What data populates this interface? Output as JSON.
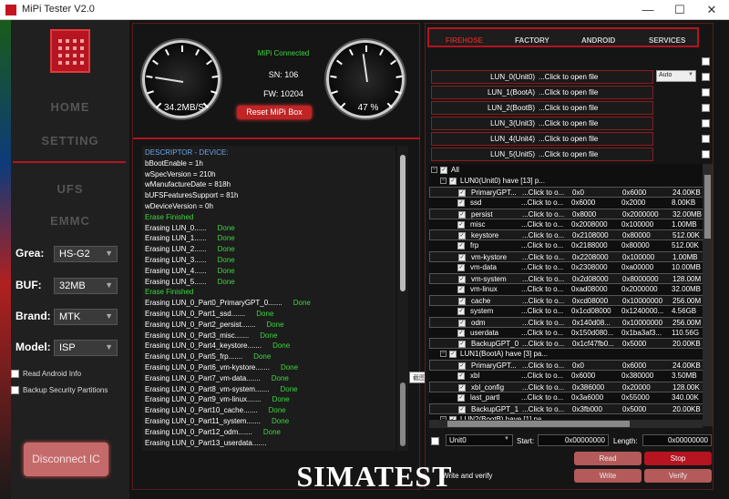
{
  "window": {
    "title": "MiPi Tester V2.0",
    "min": "—",
    "max": "☐",
    "close": "✕"
  },
  "nav": {
    "home": "HOME",
    "setting": "SETTING",
    "ufs": "UFS",
    "emmc": "EMMC"
  },
  "form": [
    {
      "label": "Grea:",
      "value": "HS-G2"
    },
    {
      "label": "BUF:",
      "value": "32MB"
    },
    {
      "label": "Brand:",
      "value": "MTK"
    },
    {
      "label": "Model:",
      "value": "ISP"
    }
  ],
  "options": {
    "read_android_info": "Read Android Info",
    "backup_security": "Backup Security Partitions"
  },
  "disconnect": "Disconnect IC",
  "gauges": {
    "speed": "34.2MB/S",
    "speed_fraction": 0.2,
    "percent": "47 %",
    "percent_fraction": 0.47
  },
  "status": {
    "connected": "MiPi Connected",
    "sn": "SN: 106",
    "fw": "FW: 10204",
    "reset": "Reset MiPi Box"
  },
  "log": [
    {
      "k": "DESCRIPTOR - DEVICE:",
      "v": "",
      "c": "lb"
    },
    {
      "k": "bBootEnable      =   1h",
      "v": "",
      "c": "lk"
    },
    {
      "k": "wSpecVersion     = 210h",
      "v": "",
      "c": "lk"
    },
    {
      "k": "wManufactureDate   = 818h",
      "v": "",
      "c": "lk"
    },
    {
      "k": "bUFSFeaturesSupport =  81h",
      "v": "",
      "c": "lk"
    },
    {
      "k": "wDeviceVersion    =  0h",
      "v": "",
      "c": "lk"
    },
    {
      "k": "Erase Finished",
      "v": "",
      "c": "lg"
    },
    {
      "k": "Erasing LUN_0......",
      "v": "Done",
      "c": "lk"
    },
    {
      "k": "Erasing LUN_1......",
      "v": "Done",
      "c": "lk"
    },
    {
      "k": "Erasing LUN_2......",
      "v": "Done",
      "c": "lk"
    },
    {
      "k": "Erasing LUN_3......",
      "v": "Done",
      "c": "lk"
    },
    {
      "k": "Erasing LUN_4......",
      "v": "Done",
      "c": "lk"
    },
    {
      "k": "Erasing LUN_5......",
      "v": "Done",
      "c": "lk"
    },
    {
      "k": "Erase Finished",
      "v": "",
      "c": "lg"
    },
    {
      "k": "Erasing LUN_0_Part0_PrimaryGPT_0.......",
      "v": "Done",
      "c": "lk"
    },
    {
      "k": "Erasing LUN_0_Part1_ssd.......",
      "v": "Done",
      "c": "lk"
    },
    {
      "k": "Erasing LUN_0_Part2_persist.......",
      "v": "Done",
      "c": "lk"
    },
    {
      "k": "Erasing LUN_0_Part3_misc.......",
      "v": "Done",
      "c": "lk"
    },
    {
      "k": "Erasing LUN_0_Part4_keystore.......",
      "v": "Done",
      "c": "lk"
    },
    {
      "k": "Erasing LUN_0_Part5_frp.......",
      "v": "Done",
      "c": "lk"
    },
    {
      "k": "Erasing LUN_0_Part6_vm-kystore.......",
      "v": "Done",
      "c": "lk"
    },
    {
      "k": "Erasing LUN_0_Part7_vm-data.......",
      "v": "Done",
      "c": "lk"
    },
    {
      "k": "Erasing LUN_0_Part8_vm-system.......",
      "v": "Done",
      "c": "lk"
    },
    {
      "k": "Erasing LUN_0_Part9_vm-linux.......",
      "v": "Done",
      "c": "lk"
    },
    {
      "k": "Erasing LUN_0_Part10_cache.......",
      "v": "Done",
      "c": "lk"
    },
    {
      "k": "Erasing LUN_0_Part11_system.......",
      "v": "Done",
      "c": "lk"
    },
    {
      "k": "Erasing LUN_0_Part12_odm.......",
      "v": "Done",
      "c": "lk"
    },
    {
      "k": "Erasing LUN_0_Part13_userdata.......",
      "v": "",
      "c": "lk"
    }
  ],
  "tooltip": "截图(Alt + A)",
  "tabs": [
    "FIREHOSE",
    "FACTORY",
    "ANDROID",
    "SERVICES"
  ],
  "luns": [
    {
      "name": "LUN_0(Unit0)",
      "path": "...Click to open file"
    },
    {
      "name": "LUN_1(BootA)",
      "path": "...Click to open file"
    },
    {
      "name": "LUN_2(BootB)",
      "path": "...Click to open file"
    },
    {
      "name": "LUN_3(Unit3)",
      "path": "...Click to open file"
    },
    {
      "name": "LUN_4(Unit4)",
      "path": "...Click to open file"
    },
    {
      "name": "LUN_5(Unit5)",
      "path": "...Click to open file"
    }
  ],
  "auto": "Auto",
  "tree": {
    "all": "All",
    "lun0": "LUN0(Unit0)   have [13] p...",
    "lun1": "LUN1(BootA)   have [3] pa...",
    "lun2": "LUN2(BootB)   have [1] pa...",
    "lun0_parts": [
      [
        "PrimaryGPT...",
        "...Click to o...",
        "0x0",
        "0x6000",
        "24.00KB"
      ],
      [
        "ssd",
        "...Click to o...",
        "0x6000",
        "0x2000",
        "8.00KB"
      ],
      [
        "persist",
        "...Click to o...",
        "0x8000",
        "0x2000000",
        "32.00MB"
      ],
      [
        "misc",
        "...Click to o...",
        "0x2008000",
        "0x100000",
        "1.00MB"
      ],
      [
        "keystore",
        "...Click to o...",
        "0x2108000",
        "0x80000",
        "512.00K"
      ],
      [
        "frp",
        "...Click to o...",
        "0x2188000",
        "0x80000",
        "512.00K"
      ],
      [
        "vm-kystore",
        "...Click to o...",
        "0x2208000",
        "0x100000",
        "1.00MB"
      ],
      [
        "vm-data",
        "...Click to o...",
        "0x2308000",
        "0xa00000",
        "10.00MB"
      ],
      [
        "vm-system",
        "...Click to o...",
        "0x2d08000",
        "0x8000000",
        "128.00M"
      ],
      [
        "vm-linux",
        "...Click to o...",
        "0xad08000",
        "0x2000000",
        "32.00MB"
      ],
      [
        "cache",
        "...Click to o...",
        "0xcd08000",
        "0x10000000",
        "256.00M"
      ],
      [
        "system",
        "...Click to o...",
        "0x1cd08000",
        "0x1240000...",
        "4.56GB"
      ],
      [
        "odm",
        "...Click to o...",
        "0x140d08...",
        "0x10000000",
        "256.00M"
      ],
      [
        "userdata",
        "...Click to o...",
        "0x150d080...",
        "0x1ba3af3...",
        "110.56G"
      ],
      [
        "BackupGPT_0",
        "...Click to o...",
        "0x1cf47fb0...",
        "0x5000",
        "20.00KB"
      ]
    ],
    "lun1_parts": [
      [
        "PrimaryGPT...",
        "...Click to o...",
        "0x0",
        "0x6000",
        "24.00KB"
      ],
      [
        "xbl",
        "...Click to o...",
        "0x6000",
        "0x380000",
        "3.50MB"
      ],
      [
        "xbl_config",
        "...Click to o...",
        "0x386000",
        "0x20000",
        "128.00K"
      ],
      [
        "last_partl",
        "...Click to o...",
        "0x3a6000",
        "0x55000",
        "340.00K"
      ],
      [
        "BackupGPT_1",
        "...Click to o...",
        "0x3fb000",
        "0x5000",
        "20.00KB"
      ]
    ]
  },
  "bottom": {
    "unit": "Unit0",
    "start_label": "Start:",
    "start": "0x00000000",
    "length_label": "Length:",
    "length": "0x00000000",
    "read": "Read",
    "stop": "Stop",
    "write": "Write",
    "verify": "Verify",
    "write_verify": "Write and verify"
  },
  "watermark": "SIMATEST"
}
